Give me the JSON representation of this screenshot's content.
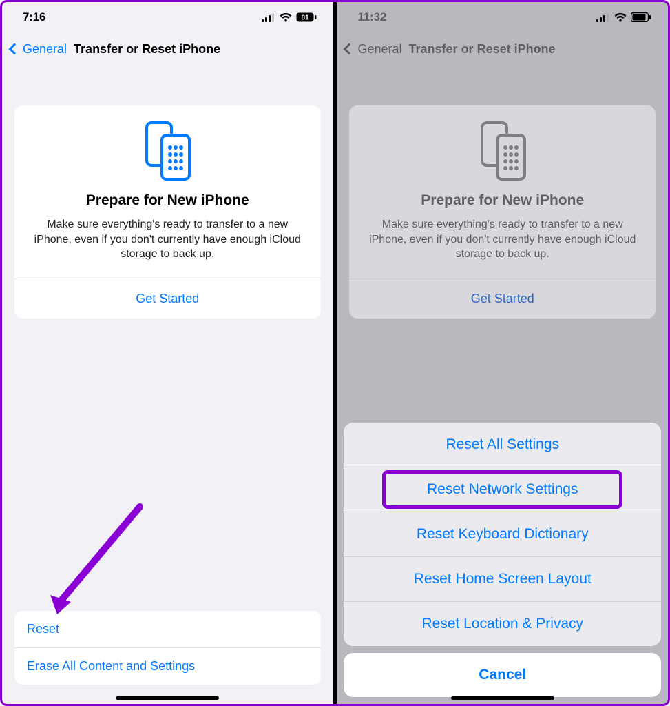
{
  "left": {
    "status": {
      "time": "7:16",
      "battery": "81"
    },
    "nav": {
      "back": "General",
      "title": "Transfer or Reset iPhone"
    },
    "card": {
      "title": "Prepare for New iPhone",
      "desc": "Make sure everything's ready to transfer to a new iPhone, even if you don't currently have enough iCloud storage to back up.",
      "link": "Get Started"
    },
    "rows": {
      "reset": "Reset",
      "erase": "Erase All Content and Settings"
    }
  },
  "right": {
    "status": {
      "time": "11:32"
    },
    "nav": {
      "back": "General",
      "title": "Transfer or Reset iPhone"
    },
    "card": {
      "title": "Prepare for New iPhone",
      "desc": "Make sure everything's ready to transfer to a new iPhone, even if you don't currently have enough iCloud storage to back up.",
      "link": "Get Started"
    },
    "sheet": {
      "options": [
        "Reset All Settings",
        "Reset Network Settings",
        "Reset Keyboard Dictionary",
        "Reset Home Screen Layout",
        "Reset Location & Privacy"
      ],
      "cancel": "Cancel"
    }
  },
  "annotations": {
    "highlight_row_index": 1,
    "arrow_target": "reset-row"
  }
}
